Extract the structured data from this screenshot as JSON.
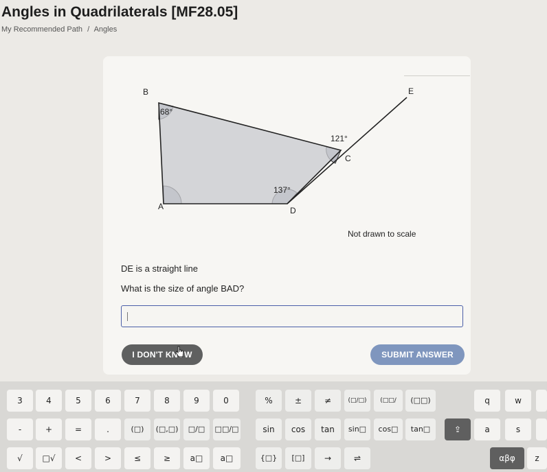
{
  "page": {
    "title": "Angles in Quadrilaterals [MF28.05]",
    "breadcrumb": [
      "My Recommended Path",
      "/",
      "Angles"
    ]
  },
  "figure": {
    "points": [
      "A",
      "B",
      "C",
      "D",
      "E"
    ],
    "angle_labels": [
      "68°",
      "121°",
      "137°"
    ],
    "note": "Not drawn to scale",
    "fill_color": "#c8c9cf"
  },
  "question": {
    "statement": "DE is a straight line",
    "prompt": "What is the size of angle BAD?",
    "answer_value": ""
  },
  "buttons": {
    "dont_know": "I DON'T KNOW",
    "submit": "SUBMIT ANSWER"
  },
  "keyboard": {
    "row1": [
      "3",
      "4",
      "5",
      "6",
      "7",
      "8",
      "9",
      "0",
      "%",
      "±",
      "≠",
      "(□/□)",
      "(□□/□□)",
      "(□□)",
      "q",
      "w"
    ],
    "row2": [
      "-",
      "+",
      "=",
      ".",
      "(□)",
      "(□,□)",
      "□/□",
      "□□/□",
      "sin",
      "cos",
      "tan",
      "sin□",
      "cos□",
      "tan□",
      "⇪",
      "a",
      "s"
    ],
    "row3": [
      "√",
      "□√",
      "<",
      ">",
      "≤",
      "≥",
      "a□",
      "a□",
      "{□}",
      "[□]",
      "→",
      "⇌",
      "αβφ",
      "z"
    ]
  }
}
